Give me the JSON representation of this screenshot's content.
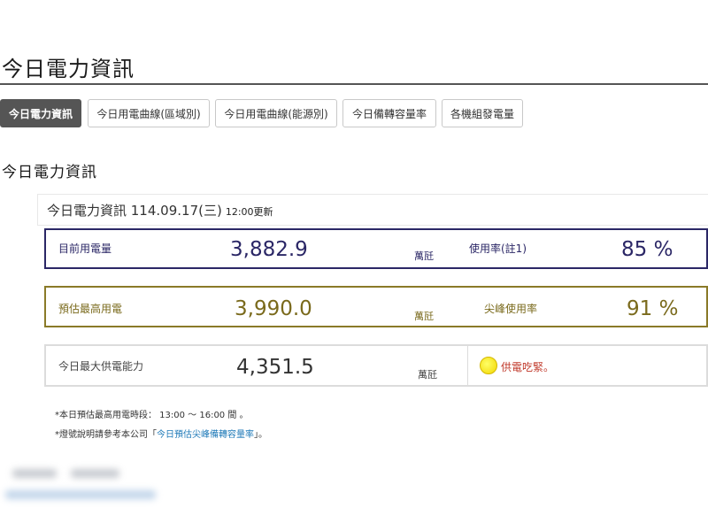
{
  "page": {
    "title": "今日電力資訊"
  },
  "tabs": [
    {
      "label": "今日電力資訊",
      "active": true
    },
    {
      "label": "今日用電曲線(區域別)",
      "active": false
    },
    {
      "label": "今日用電曲線(能源別)",
      "active": false
    },
    {
      "label": "今日備轉容量率",
      "active": false
    },
    {
      "label": "各機組發電量",
      "active": false
    }
  ],
  "section": {
    "title": "今日電力資訊"
  },
  "panel": {
    "header_date": "今日電力資訊 114.09.17(三)",
    "header_time": "12:00更新"
  },
  "rows": {
    "current": {
      "label": "目前用電量",
      "value": "3,882.9",
      "unit": "萬瓩",
      "rate_label": "使用率(註1)",
      "rate_value": "85 %",
      "color": "#2b2766"
    },
    "peak": {
      "label": "預估最高用電",
      "value": "3,990.0",
      "unit": "萬瓩",
      "rate_label": "尖峰使用率",
      "rate_value": "91 %",
      "color": "#8a7a28"
    },
    "supply": {
      "label": "今日最大供電能力",
      "value": "4,351.5",
      "unit": "萬瓩",
      "status_text": "供電吃緊。",
      "status_color": "yellow-dot"
    }
  },
  "notes": {
    "note1": "*本日預估最高用電時段： 13:00 ～ 16:00 間 。",
    "note2_prefix": "*燈號說明請參考本公司「",
    "note2_link": "今日預估尖峰備轉容量率",
    "note2_suffix": "」。"
  }
}
